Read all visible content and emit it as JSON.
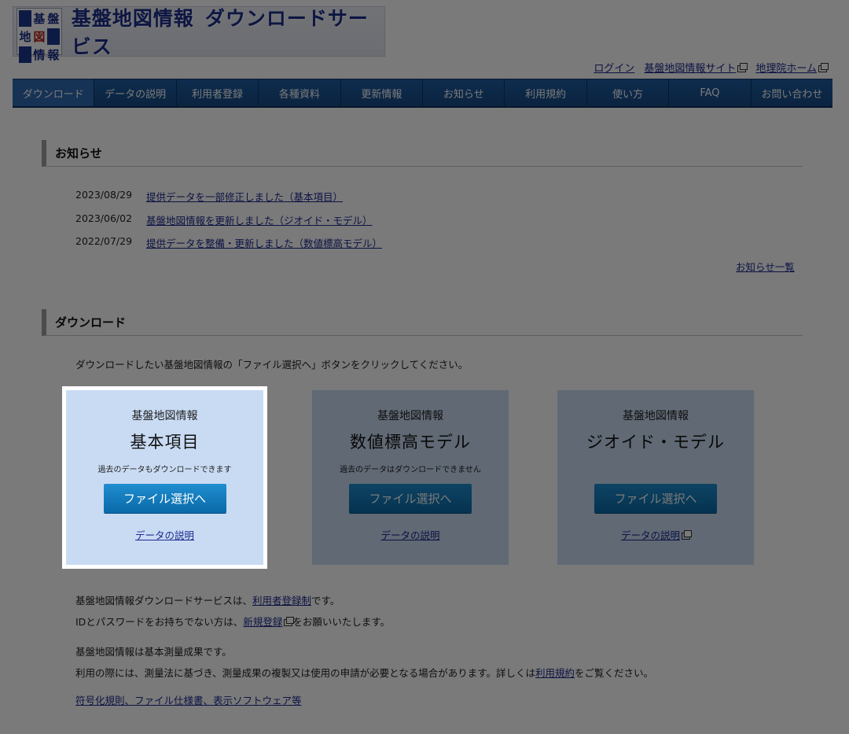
{
  "header": {
    "logo_chars": [
      "基",
      "盤",
      "地",
      "図",
      "情",
      "報"
    ],
    "title": "基盤地図情報",
    "subtitle": "ダウンロードサービス"
  },
  "util_links": [
    {
      "label": "ログイン"
    },
    {
      "label": "基盤地図情報サイト"
    },
    {
      "label": "地理院ホーム"
    }
  ],
  "nav": [
    {
      "label": "ダウンロード"
    },
    {
      "label": "データの説明"
    },
    {
      "label": "利用者登録"
    },
    {
      "label": "各種資料"
    },
    {
      "label": "更新情報"
    },
    {
      "label": "お知らせ"
    },
    {
      "label": "利用規約"
    },
    {
      "label": "使い方"
    },
    {
      "label": "FAQ"
    },
    {
      "label": "お問い合わせ"
    }
  ],
  "news": {
    "heading": "お知らせ",
    "items": [
      {
        "date": "2023/08/29",
        "text": "提供データを一部修正しました（基本項目）"
      },
      {
        "date": "2023/06/02",
        "text": "基盤地図情報を更新しました（ジオイド・モデル）"
      },
      {
        "date": "2022/07/29",
        "text": "提供データを整備・更新しました（数値標高モデル）"
      }
    ],
    "more": "お知らせ一覧"
  },
  "download": {
    "heading": "ダウンロード",
    "intro": "ダウンロードしたい基盤地図情報の「ファイル選択へ」ボタンをクリックしてください。",
    "cards": [
      {
        "kind": "基盤地図情報",
        "name": "基本項目",
        "note": "過去のデータもダウンロードできます",
        "button": "ファイル選択へ",
        "desc": "データの説明"
      },
      {
        "kind": "基盤地図情報",
        "name": "数値標高モデル",
        "note": "過去のデータはダウンロードできません",
        "button": "ファイル選択へ",
        "desc": "データの説明"
      },
      {
        "kind": "基盤地図情報",
        "name": "ジオイド・モデル",
        "note": "",
        "button": "ファイル選択へ",
        "desc": "データの説明"
      }
    ]
  },
  "info": {
    "line1_pre": "基盤地図情報ダウンロードサービスは、",
    "line1_link": "利用者登録制",
    "line1_post": "です。",
    "line2_pre": "IDとパスワードをお持ちでない方は、",
    "line2_link": "新規登録",
    "line2_post": "をお願いいたします。",
    "line3": "基盤地図情報は基本測量成果です。",
    "line4_pre": "利用の際には、測量法に基づき、測量成果の複製又は使用の申請が必要となる場合があります。詳しくは",
    "line4_link": "利用規約",
    "line4_post": "をご覧ください。",
    "line5_link": "符号化規則、ファイル仕様書、表示ソフトウェア等"
  }
}
